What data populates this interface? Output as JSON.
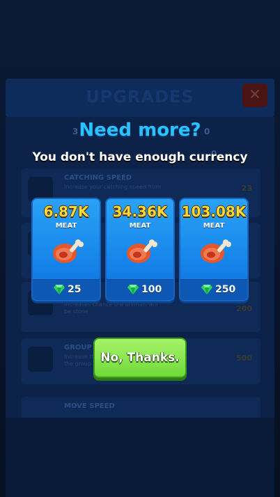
{
  "background": {
    "title": "UPGRADES",
    "close_label": "✕",
    "resources": [
      "3",
      "0",
      "0"
    ],
    "cards": [
      {
        "label": "CATCHING SPEED",
        "description": "Increase your catching speed from",
        "cost": "23"
      },
      {
        "label": "",
        "description": "",
        "cost": ""
      },
      {
        "label": "",
        "description": "Increases chance the animals will be stone",
        "cost": "200"
      },
      {
        "label": "GROUP",
        "description": "Increase the number of animals in the group from 5",
        "cost": "500"
      },
      {
        "label": "MOVE SPEED",
        "description": "",
        "cost": ""
      }
    ]
  },
  "dialog": {
    "headline": "Need more?",
    "subline": "You don't have enough currency",
    "offers": [
      {
        "amount": "6.87K",
        "resource": "MEAT",
        "price": "25"
      },
      {
        "amount": "34.36K",
        "resource": "MEAT",
        "price": "100"
      },
      {
        "amount": "103.08K",
        "resource": "MEAT",
        "price": "250"
      }
    ],
    "decline_label": "No, Thanks."
  },
  "colors": {
    "headline": "#29c3ff",
    "offer_card": "#1a8cf0",
    "amount": "#ffd83a",
    "decline_button": "#7fe04a"
  },
  "icons": {
    "offer_resource": "meat-icon",
    "offer_price": "gem-icon"
  }
}
